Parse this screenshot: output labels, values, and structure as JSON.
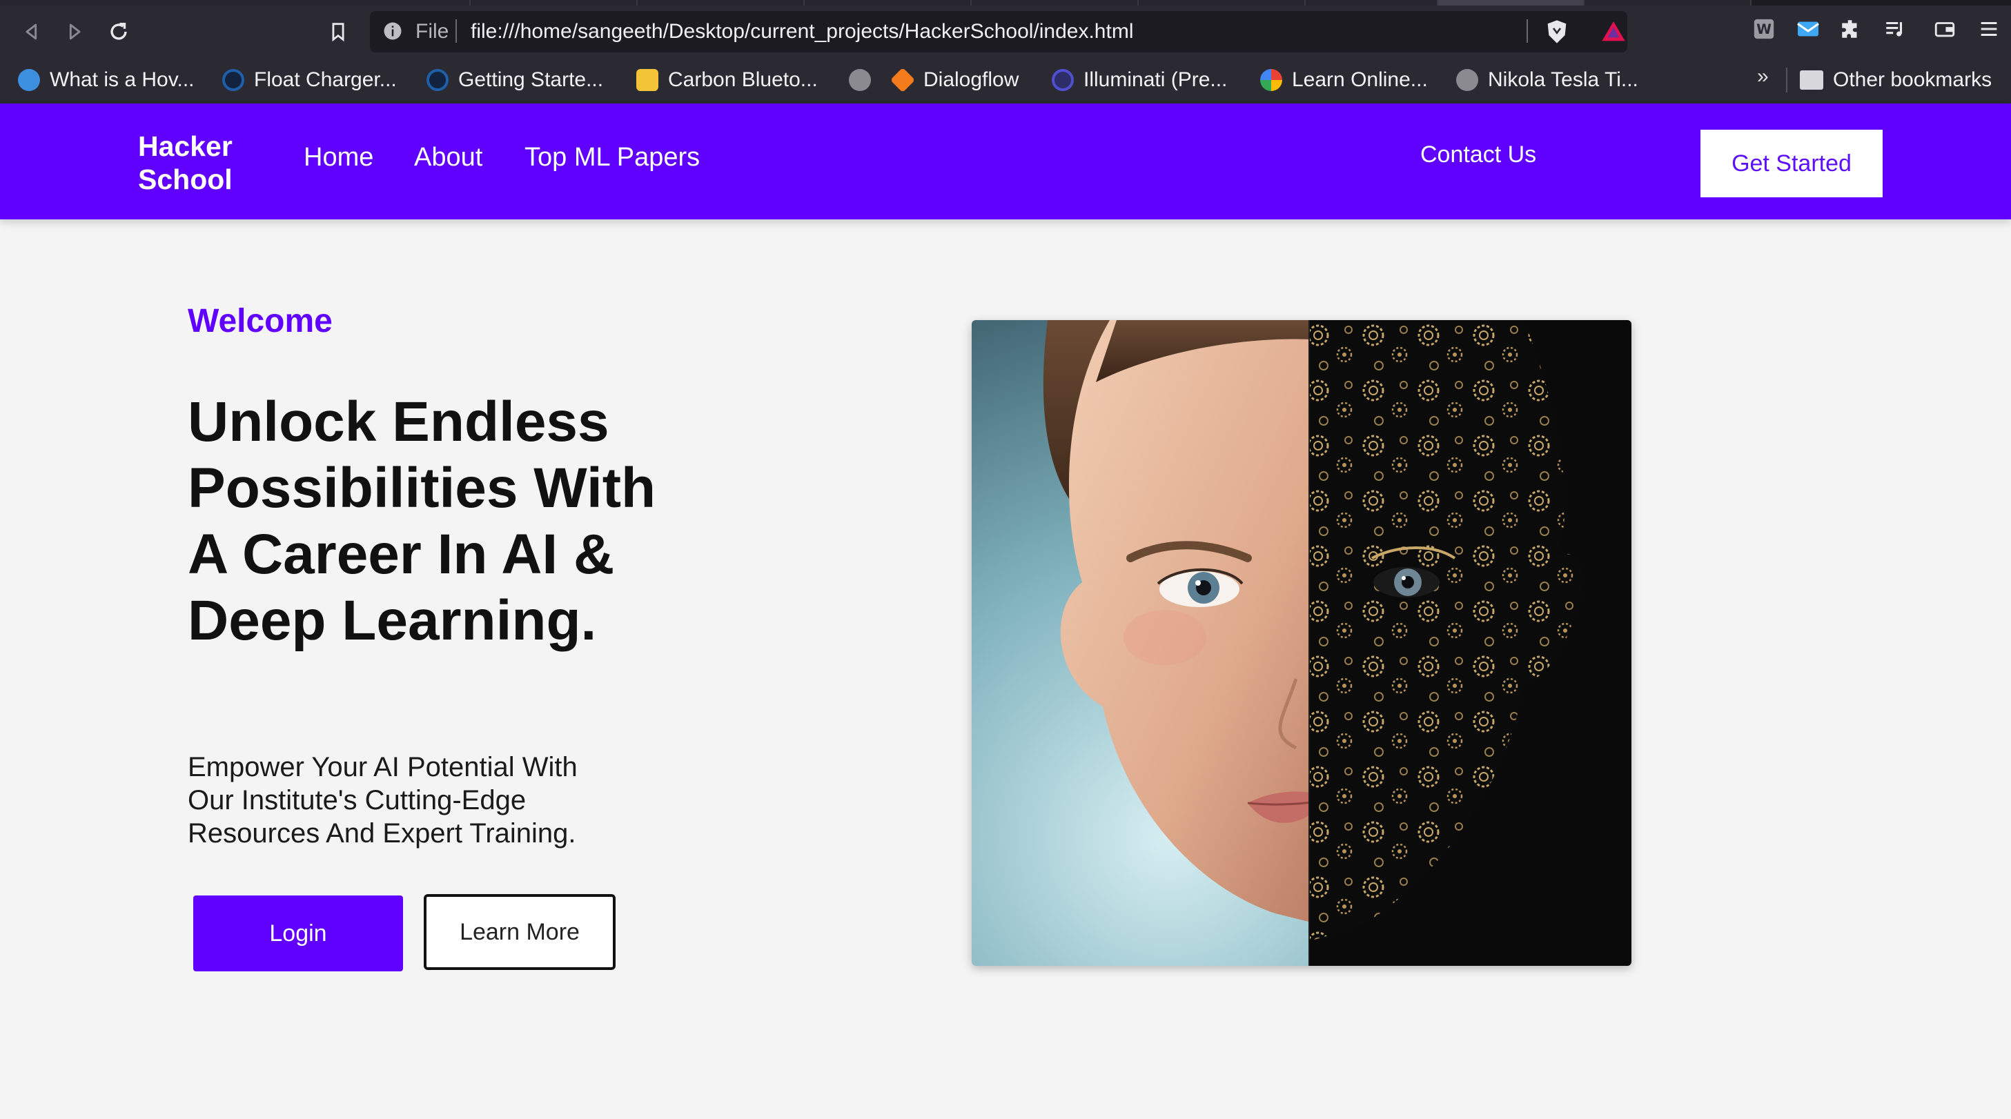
{
  "browser": {
    "url_scheme": "File",
    "url": "file:///home/sangeeth/Desktop/current_projects/HackerSchool/index.html",
    "bookmarks": [
      {
        "label": "What is a Hov...",
        "icon": "globe-icon",
        "color": "#3d8fe0"
      },
      {
        "label": "Float Charger...",
        "icon": "chip-icon",
        "color": "#1f5fa8"
      },
      {
        "label": "Getting Starte...",
        "icon": "chip-icon",
        "color": "#1f5fa8"
      },
      {
        "label": "Carbon Blueto...",
        "icon": "emoji-icon",
        "color": "#f3c338"
      },
      {
        "label": "",
        "icon": "globe-icon",
        "color": "#8a8a90"
      },
      {
        "label": "Dialogflow",
        "icon": "dialogflow-icon",
        "color": "#f47c1c"
      },
      {
        "label": "Illuminati (Pre...",
        "icon": "illuminati-icon",
        "color": "#4f4fd0"
      },
      {
        "label": "Learn Online...",
        "icon": "google-icon",
        "color": "#ffffff"
      },
      {
        "label": "Nikola Tesla Ti...",
        "icon": "globe-icon",
        "color": "#8a8a90"
      }
    ],
    "more_label": "»",
    "other_bookmarks": "Other bookmarks"
  },
  "site": {
    "brand": "Hacker School",
    "nav": [
      "Home",
      "About",
      "Top ML Papers"
    ],
    "contact": "Contact Us",
    "cta": "Get Started",
    "accent": "#6001ff"
  },
  "hero": {
    "welcome": "Welcome",
    "headline": "Unlock Endless Possibilities With A Career In AI & Deep Learning.",
    "subtitle": "Empower Your AI Potential With Our Institute's Cutting-Edge Resources And Expert Training.",
    "login": "Login",
    "learn_more": "Learn More",
    "image": "half-human half-mechanical face with gears"
  }
}
